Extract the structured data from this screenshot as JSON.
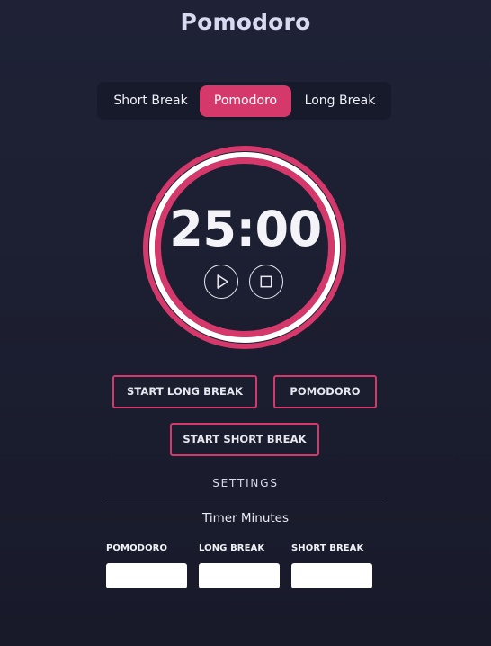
{
  "app": {
    "title": "Pomodoro"
  },
  "tabs": [
    {
      "label": "Short Break",
      "active": false
    },
    {
      "label": "Pomodoro",
      "active": true
    },
    {
      "label": "Long Break",
      "active": false
    }
  ],
  "timer": {
    "display": "25:00",
    "play_icon": "play-icon",
    "stop_icon": "stop-icon"
  },
  "actions": {
    "start_long_break": "START LONG BREAK",
    "pomodoro": "POMODORO",
    "start_short_break": "START SHORT BREAK"
  },
  "settings": {
    "heading": "SETTINGS",
    "subheading": "Timer Minutes",
    "fields": [
      {
        "label": "POMODORO",
        "value": ""
      },
      {
        "label": "LONG BREAK",
        "value": ""
      },
      {
        "label": "SHORT BREAK",
        "value": ""
      }
    ]
  },
  "colors": {
    "accent": "#d5386a",
    "background": "#1c1f31",
    "tab_bar": "#171a2b",
    "ring_white": "#ffffff"
  }
}
